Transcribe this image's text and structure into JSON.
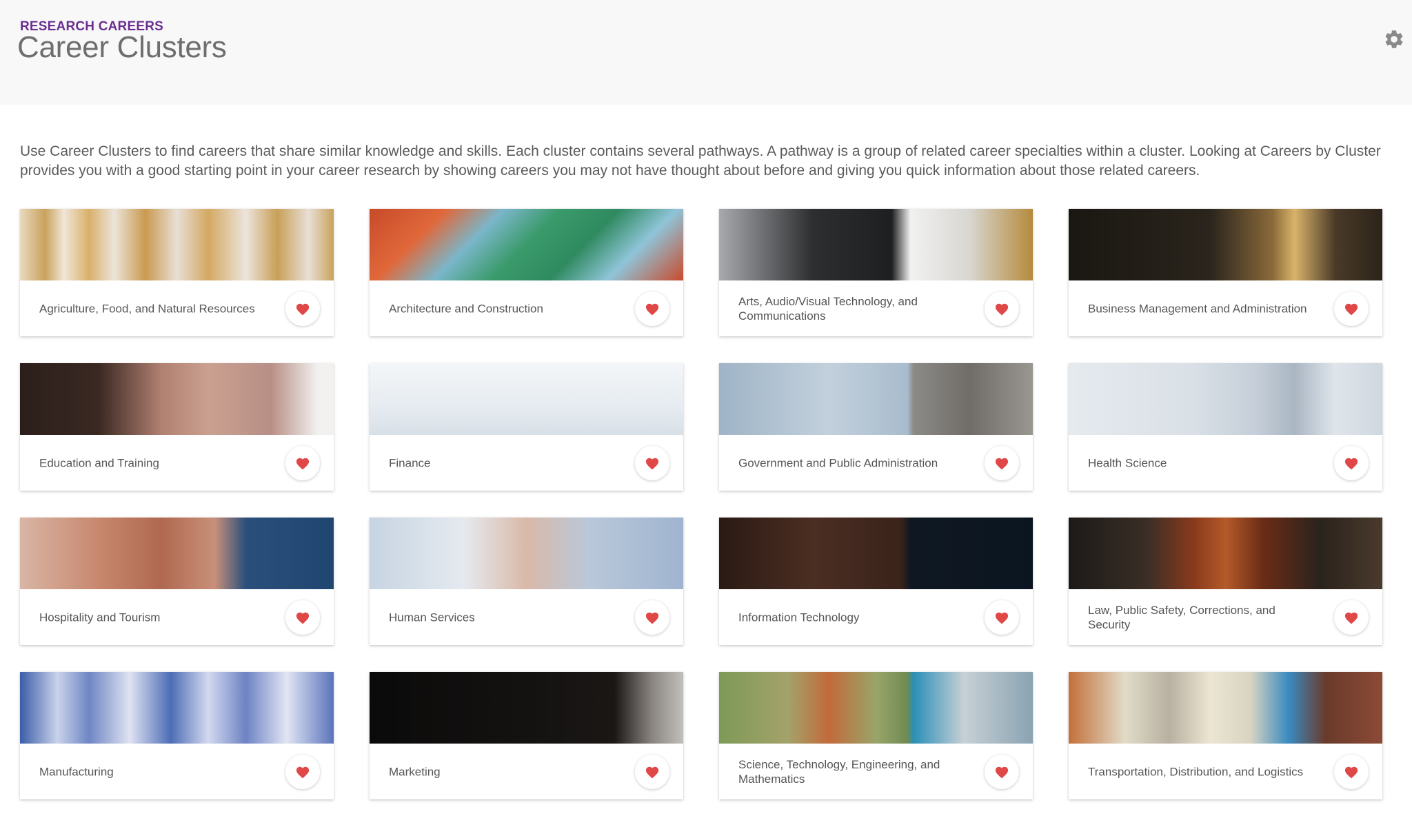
{
  "header": {
    "eyebrow": "RESEARCH CAREERS",
    "title": "Career Clusters",
    "settings_icon": "gear-icon"
  },
  "intro": "Use Career Clusters to find careers that share similar knowledge and skills. Each cluster contains several pathways. A pathway is a group of related career specialties within a cluster. Looking at Careers by Cluster provides you with a good starting point in your career research by showing careers you may not have thought about before and giving you quick information about those related careers.",
  "colors": {
    "accent": "#6a2f8f",
    "heart": "#e04848",
    "header_bg": "#f8f8f9"
  },
  "clusters": [
    {
      "label": "Agriculture, Food, and Natural Resources",
      "image_bg": "linear-gradient(90deg,#e9d9bf 0%,#c9a25c 8%,#f0e6d8 14%,#d9b06a 22%,#ece4da 30%,#c99a50 40%,#e8dfd6 50%,#d4a862 60%,#ece4dc 72%,#c8a058 82%,#e8dfd6 92%,#c9a25c 100%)"
    },
    {
      "label": "Architecture and Construction",
      "image_bg": "linear-gradient(135deg,#c84a2a 0%,#e0683a 20%,#7ab6c9 35%,#3a9a6a 50%,#2f8a60 65%,#8fc4d8 80%,#c94a2c 100%)"
    },
    {
      "label": "Arts, Audio/Visual Technology, and Communications",
      "image_bg": "linear-gradient(90deg,#a8a9ad 0%,#2d2e30 30%,#1e1f20 55%,#f1f1f1 61%,#d8d6d0 80%,#b58a3c 100%)"
    },
    {
      "label": "Business Management and Administration",
      "image_bg": "linear-gradient(90deg,#1a1712 0%,#2a241c 45%,#8a6a3a 65%,#d9b36a 72%,#4a3a28 85%,#2b231a 100%)"
    },
    {
      "label": "Education and Training",
      "image_bg": "linear-gradient(90deg,#2b1f1b 0%,#3a2822 25%,#b08070 45%,#caa090 60%,#b88f86 80%,#f3f1f0 95%)"
    },
    {
      "label": "Finance",
      "image_bg": "linear-gradient(180deg,#f4f6f8 0%,#e6ecf1 60%,#d8e0e7 100%)"
    },
    {
      "label": "Government and Public Administration",
      "image_bg": "linear-gradient(90deg,#9fb4c7 0%,#c2d0dc 35%,#a9bccd 60%,#8c8a86 62%,#706d69 80%,#9a9690 100%)"
    },
    {
      "label": "Health Science",
      "image_bg": "linear-gradient(90deg,#e5eaef 0%,#d9e0e6 40%,#c5ced8 60%,#aab6c3 72%,#dfe5ea 85%,#cfd7df 100%)"
    },
    {
      "label": "Hospitality and Tourism",
      "image_bg": "linear-gradient(90deg,#d9b5a5 0%,#c7886e 25%,#b06850 45%,#c9907a 62%,#2a4f7a 72%,#1f4670 100%)"
    },
    {
      "label": "Human Services",
      "image_bg": "linear-gradient(90deg,#c7d4e2 0%,#e5eaf0 30%,#d9b9a8 50%,#b9c8da 70%,#9fb4cf 100%)"
    },
    {
      "label": "Information Technology",
      "image_bg": "linear-gradient(90deg,#2a1a14 0%,#4b2e22 30%,#3a231b 58%,#0f1822 61%,#0b1520 100%)"
    },
    {
      "label": "Law, Public Safety, Corrections, and Security",
      "image_bg": "linear-gradient(90deg,#1c1a18 0%,#3a2e26 25%,#8a3a1c 40%,#b45a2a 50%,#6a2c16 62%,#2a231d 80%,#4a3a2c 100%)"
    },
    {
      "label": "Manufacturing",
      "image_bg": "linear-gradient(90deg,#3c5ea8 0%,#c9d2ea 12%,#6e86c4 22%,#dfe3f2 35%,#4d6db5 48%,#d3d9ef 60%,#6d83c3 72%,#e1e5f3 85%,#5a74bb 100%)"
    },
    {
      "label": "Marketing",
      "image_bg": "linear-gradient(90deg,#0b0a0a 0%,#141211 50%,#1a1715 78%,#8a8580 90%,#c2bfbc 100%)"
    },
    {
      "label": "Science, Technology, Engineering, and Mathematics",
      "image_bg": "linear-gradient(90deg,#7e9a58 0%,#a3a26a 22%,#c26a3a 35%,#9aa56a 50%,#6f8b52 60%,#2a8fb8 62%,#c7d0d5 78%,#8aa3b3 100%)"
    },
    {
      "label": "Transportation, Distribution, and Logistics",
      "image_bg": "linear-gradient(90deg,#c3703a 0%,#e1dbc8 18%,#b8b0a0 32%,#ebe5d2 45%,#d9d3c2 58%,#3a8bc0 70%,#6a3a2a 82%,#8c4a36 100%)"
    }
  ]
}
